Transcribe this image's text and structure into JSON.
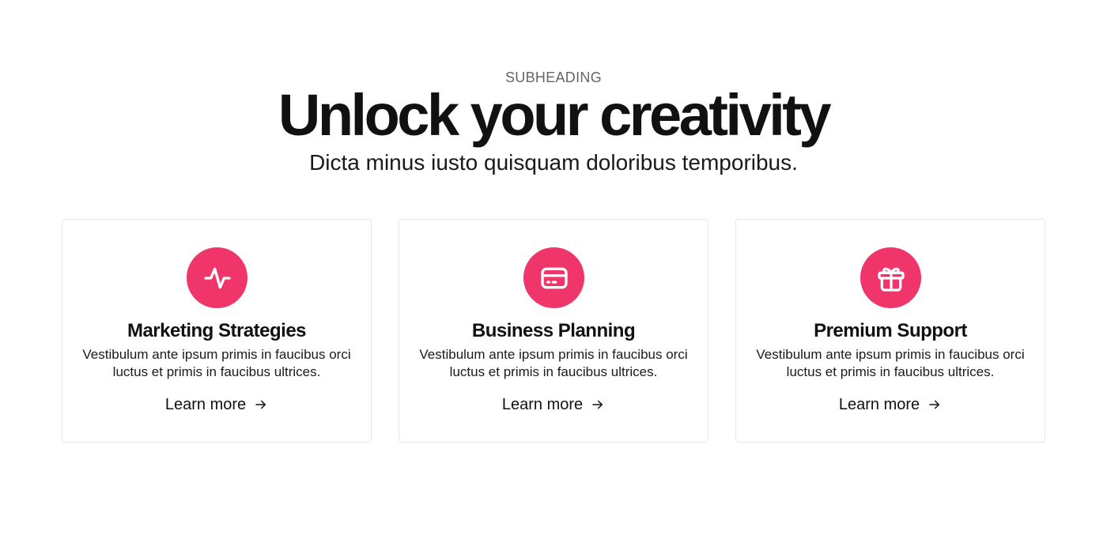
{
  "header": {
    "subheading": "SUBHEADING",
    "title": "Unlock your creativity",
    "tagline": "Dicta minus iusto quisquam doloribus temporibus."
  },
  "colors": {
    "accent": "#ef3569",
    "text": "#111111",
    "muted": "#666666",
    "card_border": "#e6e6e6"
  },
  "cards": [
    {
      "icon": "activity-icon",
      "title": "Marketing Strategies",
      "description": "Vestibulum ante ipsum primis in faucibus orci luctus et primis in faucibus ultrices.",
      "link_label": "Learn more"
    },
    {
      "icon": "credit-card-icon",
      "title": "Business Planning",
      "description": "Vestibulum ante ipsum primis in faucibus orci luctus et primis in faucibus ultrices.",
      "link_label": "Learn more"
    },
    {
      "icon": "gift-icon",
      "title": "Premium Support",
      "description": "Vestibulum ante ipsum primis in faucibus orci luctus et primis in faucibus ultrices.",
      "link_label": "Learn more"
    }
  ]
}
